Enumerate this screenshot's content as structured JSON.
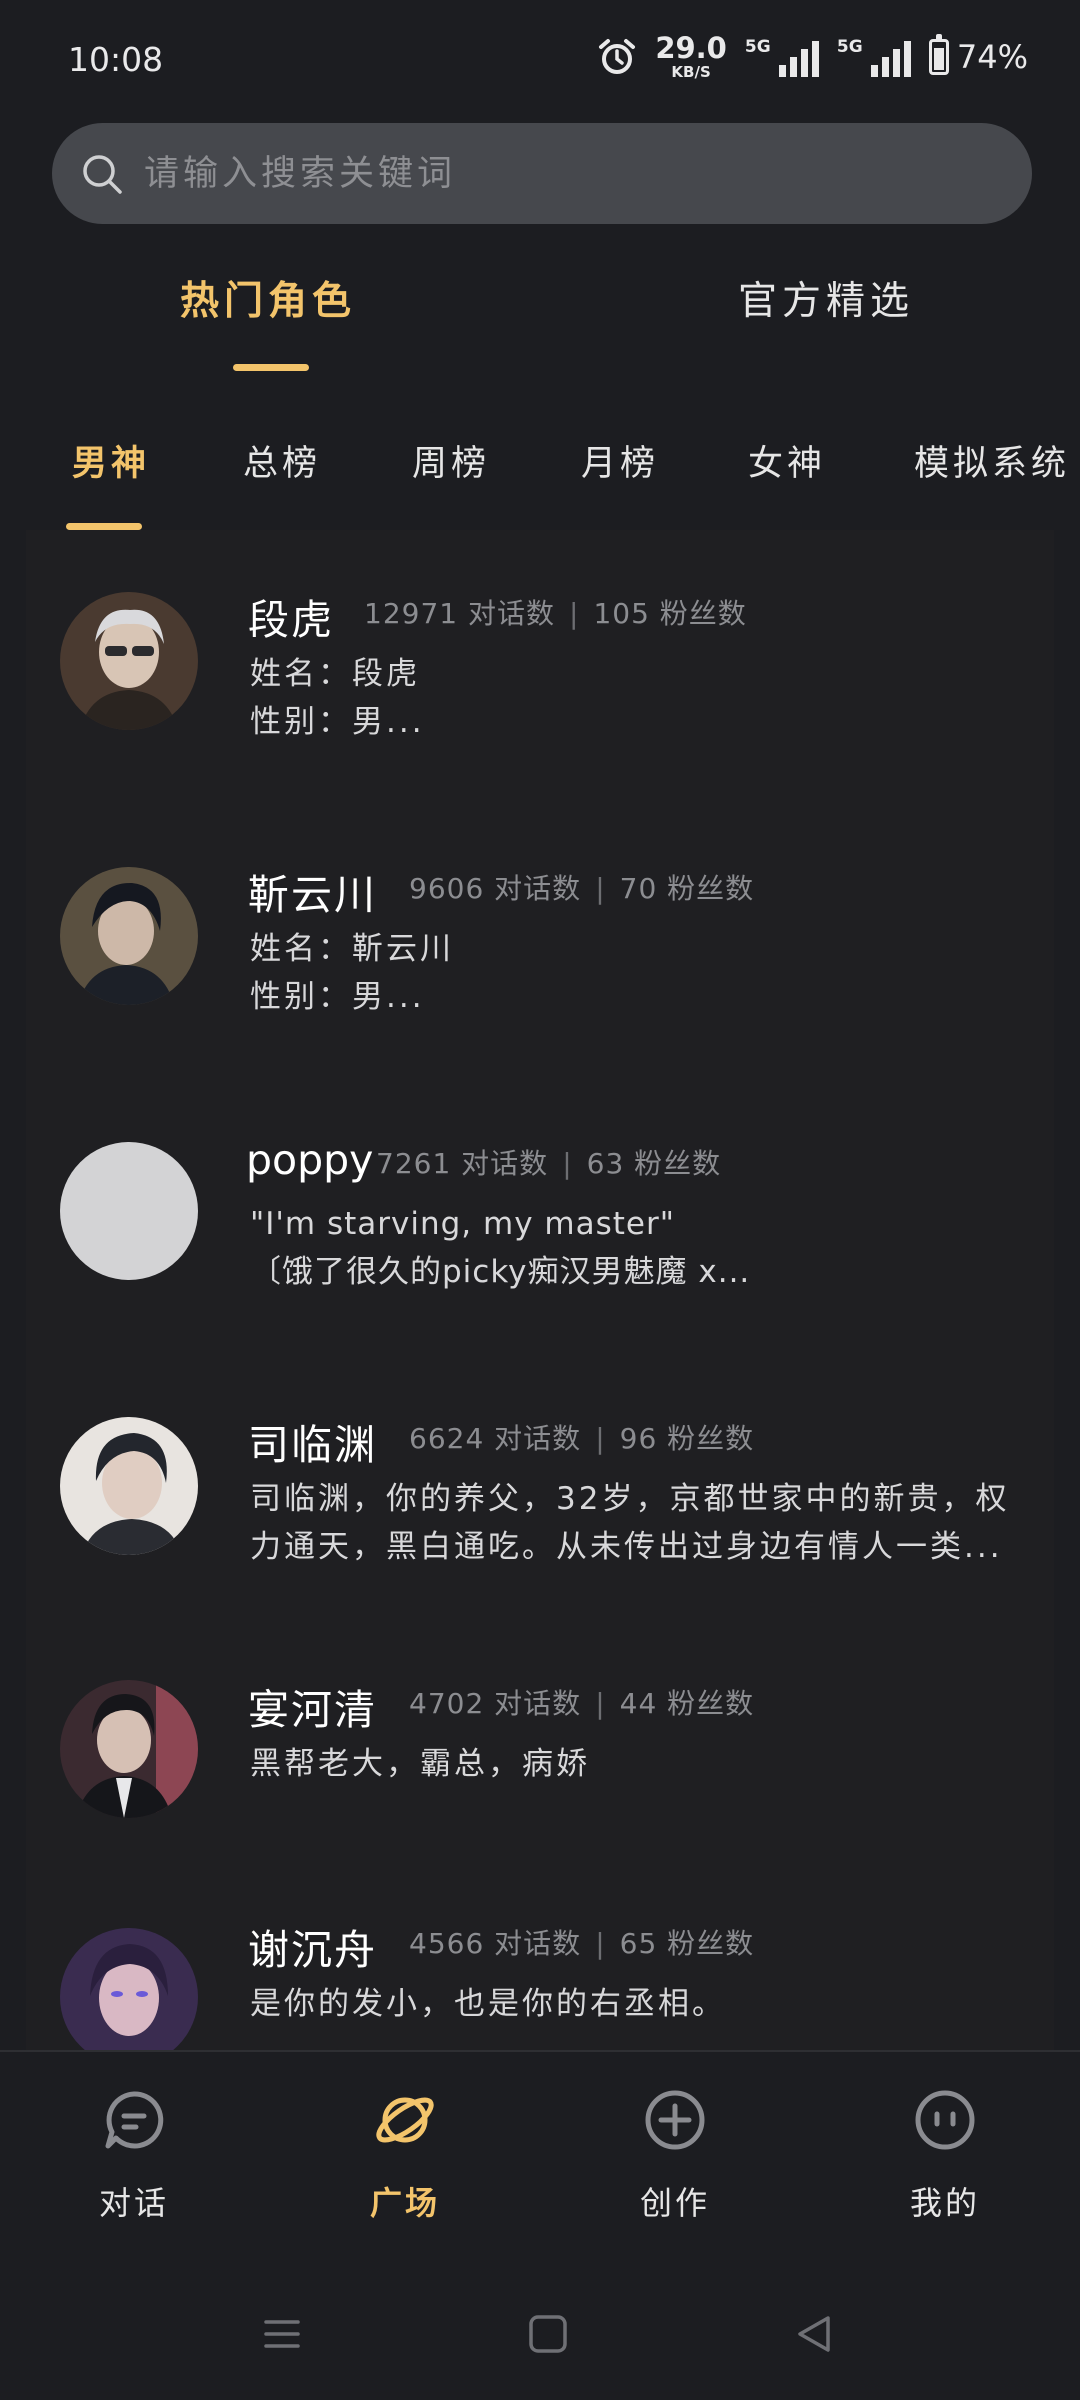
{
  "status_bar": {
    "time": "10:08",
    "net_speed": "29.0",
    "net_unit": "KB/S",
    "sim1": "5G",
    "sim2": "5G",
    "battery": "74%"
  },
  "search": {
    "placeholder": "请输入搜索关键词"
  },
  "primary_tabs": [
    {
      "label": "热门角色",
      "active": true
    },
    {
      "label": "官方精选",
      "active": false
    }
  ],
  "secondary_tabs": [
    {
      "label": "男神",
      "active": true
    },
    {
      "label": "总榜",
      "active": false
    },
    {
      "label": "周榜",
      "active": false
    },
    {
      "label": "月榜",
      "active": false
    },
    {
      "label": "女神",
      "active": false
    },
    {
      "label": "模拟系统",
      "active": false
    }
  ],
  "stats_labels": {
    "dialogs": "对话数",
    "fans": "粉丝数",
    "separator": "|"
  },
  "characters": [
    {
      "name": "段虎",
      "dialogs": "12971",
      "fans": "105",
      "desc_line1": "姓名：段虎",
      "desc_line2": "性别：男..."
    },
    {
      "name": "靳云川",
      "dialogs": "9606",
      "fans": "70",
      "desc_line1": "姓名：靳云川",
      "desc_line2": "性别：男..."
    },
    {
      "name": "poppy",
      "dialogs": "7261",
      "fans": "63",
      "desc_line1": "\"I'm starving, my master\"",
      "desc_line2": "〔饿了很久的picky痴汉男魅魔 x..."
    },
    {
      "name": "司临渊",
      "dialogs": "6624",
      "fans": "96",
      "desc_line1": "司临渊，你的养父，32岁，京都世家中的新贵，权",
      "desc_line2": "力通天，黑白通吃。从未传出过身边有情人一类..."
    },
    {
      "name": "宴河清",
      "dialogs": "4702",
      "fans": "44",
      "desc_line1": "黑帮老大，霸总，病娇",
      "desc_line2": ""
    },
    {
      "name": "谢沉舟",
      "dialogs": "4566",
      "fans": "65",
      "desc_line1": "是你的发小，也是你的右丞相。",
      "desc_line2": ""
    }
  ],
  "bottom_nav": [
    {
      "label": "对话",
      "icon": "chat-bubble-icon",
      "active": false
    },
    {
      "label": "广场",
      "icon": "planet-icon",
      "active": true
    },
    {
      "label": "创作",
      "icon": "plus-circle-icon",
      "active": false
    },
    {
      "label": "我的",
      "icon": "face-icon",
      "active": false
    }
  ],
  "colors": {
    "accent": "#f3c46b",
    "background": "#1c1d21",
    "search_bg": "#46484d",
    "muted": "#8c8d91"
  }
}
